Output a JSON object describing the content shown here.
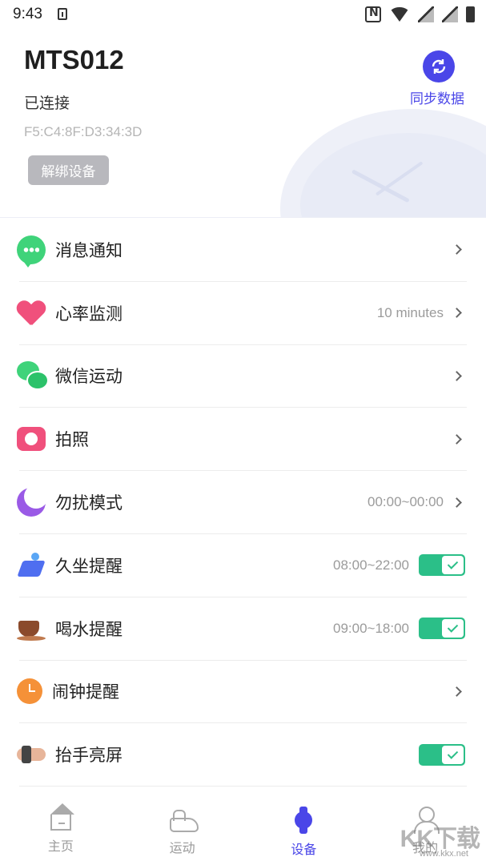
{
  "status_bar": {
    "time": "9:43"
  },
  "device": {
    "name": "MTS012",
    "connection_status": "已连接",
    "mac": "F5:C4:8F:D3:34:3D",
    "unbind_label": "解绑设备",
    "sync_label": "同步数据"
  },
  "settings": [
    {
      "label": "消息通知",
      "value": "",
      "control": "chevron",
      "icon": "message-icon"
    },
    {
      "label": "心率监测",
      "value": "10 minutes",
      "control": "chevron",
      "icon": "heart-icon"
    },
    {
      "label": "微信运动",
      "value": "",
      "control": "chevron",
      "icon": "wechat-icon"
    },
    {
      "label": "拍照",
      "value": "",
      "control": "chevron",
      "icon": "camera-icon"
    },
    {
      "label": "勿扰模式",
      "value": "00:00~00:00",
      "control": "chevron",
      "icon": "moon-icon"
    },
    {
      "label": "久坐提醒",
      "value": "08:00~22:00",
      "control": "toggle-on",
      "icon": "sitting-icon"
    },
    {
      "label": "喝水提醒",
      "value": "09:00~18:00",
      "control": "toggle-on",
      "icon": "cup-icon"
    },
    {
      "label": "闹钟提醒",
      "value": "",
      "control": "chevron",
      "icon": "alarm-icon"
    },
    {
      "label": "抬手亮屏",
      "value": "",
      "control": "toggle-on",
      "icon": "wrist-icon"
    }
  ],
  "nav": [
    {
      "label": "主页",
      "icon": "home-icon",
      "active": false
    },
    {
      "label": "运动",
      "icon": "shoe-icon",
      "active": false
    },
    {
      "label": "设备",
      "icon": "watch-icon",
      "active": true
    },
    {
      "label": "我的",
      "icon": "user-icon",
      "active": false
    }
  ],
  "watermark": {
    "text": "KK下载",
    "url": "www.kkx.net"
  },
  "colors": {
    "accent": "#4a46e8",
    "toggle_on": "#2bbf88",
    "heart": "#f0507c",
    "green": "#3fd37a"
  }
}
